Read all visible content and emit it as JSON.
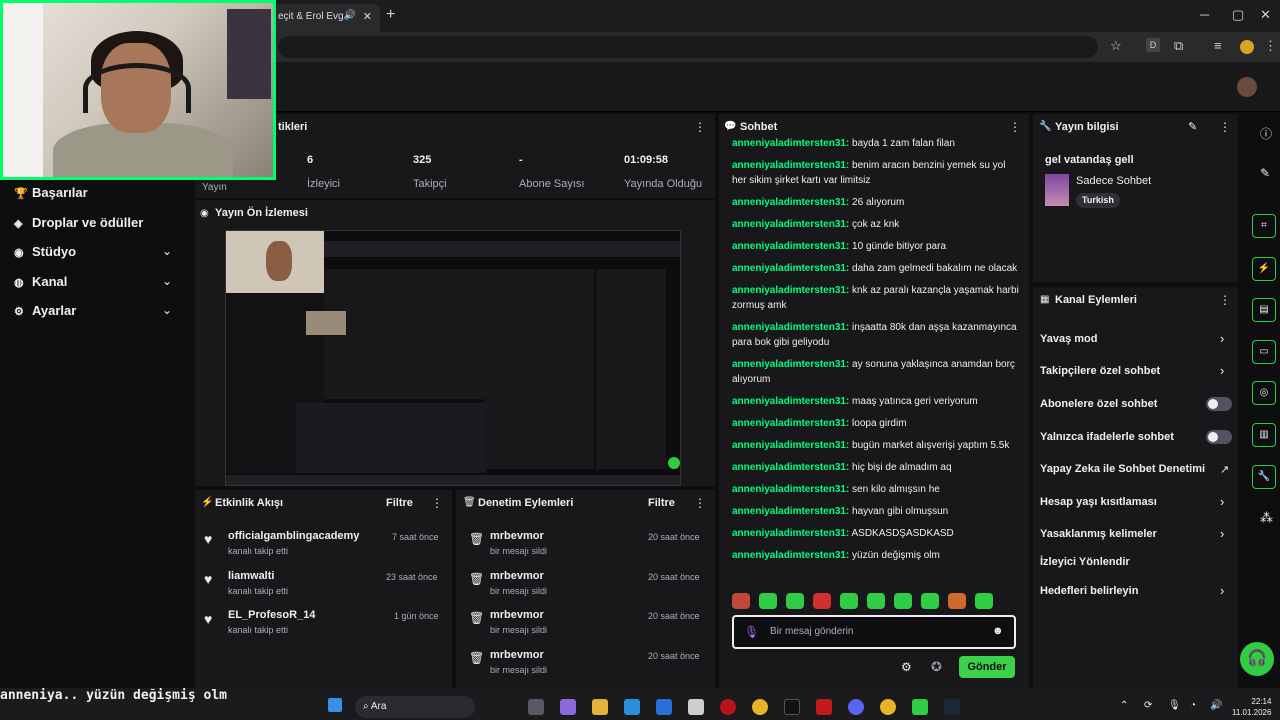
{
  "browser": {
    "tab_title": "eçit & Erol Evg",
    "tab_audio_icon": "speaker-icon",
    "new_tab": "+",
    "minimize": "─",
    "maximize": "▢",
    "close": "✕"
  },
  "sidebar": {
    "items": [
      {
        "label": "Başarılar",
        "icon": "trophy-icon",
        "glyph": "🏆",
        "chevron": false
      },
      {
        "label": "Droplar ve ödüller",
        "icon": "gift-icon",
        "glyph": "◈",
        "chevron": false
      },
      {
        "label": "Stüdyo",
        "icon": "studio-icon",
        "glyph": "◉",
        "chevron": true
      },
      {
        "label": "Kanal",
        "icon": "channel-icon",
        "glyph": "◍",
        "chevron": true
      },
      {
        "label": "Ayarlar",
        "icon": "gear-icon",
        "glyph": "⚙",
        "chevron": true
      }
    ],
    "chevron_glyph": "⌄"
  },
  "stats": {
    "title_fragment": "tikleri",
    "yayin_label": "Yayın",
    "items": [
      {
        "value": "6",
        "label": "İzleyici"
      },
      {
        "value": "325",
        "label": "Takipçi"
      },
      {
        "value": "-",
        "label": "Abone Sayısı"
      },
      {
        "value": "01:09:58",
        "label": "Yayında Olduğu"
      }
    ]
  },
  "preview": {
    "title": "Yayın Ön İzlemesi"
  },
  "activity": {
    "title": "Etkinlik Akışı",
    "filter": "Filtre",
    "items": [
      {
        "name": "officialgamblingacademy",
        "sub": "kanalı takip etti",
        "time": "7 saat önce"
      },
      {
        "name": "liamwalti",
        "sub": "kanalı takip etti",
        "time": "23 saat önce"
      },
      {
        "name": "EL_ProfesoR_14",
        "sub": "kanalı takip etti",
        "time": "1 gün önce"
      }
    ]
  },
  "moderation": {
    "title": "Denetim Eylemleri",
    "filter": "Filtre",
    "items": [
      {
        "name": "mrbevmor",
        "sub": "bir mesajı sildi",
        "time": "20 saat önce"
      },
      {
        "name": "mrbevmor",
        "sub": "bir mesajı sildi",
        "time": "20 saat önce"
      },
      {
        "name": "mrbevmor",
        "sub": "bir mesajı sildi",
        "time": "20 saat önce"
      },
      {
        "name": "mrbevmor",
        "sub": "bir mesajı sildi",
        "time": "20 saat önce"
      }
    ]
  },
  "chat": {
    "title": "Sohbet",
    "messages": [
      {
        "user": "anneniyaladimtersten31:",
        "text": "bayda 1 zam falan filan"
      },
      {
        "user": "anneniyaladimtersten31:",
        "text": "benim aracın benzini yemek su yol her sikim şirket kartı var limitsiz"
      },
      {
        "user": "anneniyaladimtersten31:",
        "text": "26 alıyorum"
      },
      {
        "user": "anneniyaladimtersten31:",
        "text": "çok az knk"
      },
      {
        "user": "anneniyaladimtersten31:",
        "text": "10 günde bitiyor para"
      },
      {
        "user": "anneniyaladimtersten31:",
        "text": "daha zam gelmedi bakalım ne olacak"
      },
      {
        "user": "anneniyaladimtersten31:",
        "text": "knk az paralı kazançla yaşamak harbi zormuş amk"
      },
      {
        "user": "anneniyaladimtersten31:",
        "text": "inşaatta 80k dan aşşa kazanmayınca para bok gibi geliyodu"
      },
      {
        "user": "anneniyaladimtersten31:",
        "text": "ay sonuna yaklaşınca anamdan borç alıyorum"
      },
      {
        "user": "anneniyaladimtersten31:",
        "text": "maaş yatınca geri veriyorum"
      },
      {
        "user": "anneniyaladimtersten31:",
        "text": "loopa girdim"
      },
      {
        "user": "anneniyaladimtersten31:",
        "text": "bugün market alışverişi yaptım 5.5k"
      },
      {
        "user": "anneniyaladimtersten31:",
        "text": "hiç bişi de almadım aq"
      },
      {
        "user": "anneniyaladimtersten31:",
        "text": "sen kilo almışsın he"
      },
      {
        "user": "anneniyaladimtersten31:",
        "text": "hayvan gibi olmuşsun"
      },
      {
        "user": "anneniyaladimtersten31:",
        "text": "ASDKASDŞASDKASD"
      },
      {
        "user": "anneniyaladimtersten31:",
        "text": "yüzün değişmiş olm"
      }
    ],
    "input_placeholder": "Bir mesaj gönderin",
    "send_label": "Gönder",
    "emote_color": "#2fcc44"
  },
  "stream_info": {
    "title": "Yayın bilgisi",
    "stream_title": "gel vatandaş gell",
    "category": "Sadece Sohbet",
    "tag": "Turkish"
  },
  "channel_actions": {
    "title": "Kanal Eylemleri",
    "items": [
      {
        "label": "Yavaş mod",
        "control": "chevron"
      },
      {
        "label": "Takipçilere özel sohbet",
        "control": "chevron"
      },
      {
        "label": "Abonelere özel sohbet",
        "control": "toggle"
      },
      {
        "label": "Yalnızca ifadelerle sohbet",
        "control": "toggle"
      },
      {
        "label": "Yapay Zeka ile Sohbet Denetimi",
        "control": "external"
      },
      {
        "label": "Hesap yaşı kısıtlaması",
        "control": "chevron"
      },
      {
        "label": "Yasaklanmış kelimeler",
        "control": "chevron"
      },
      {
        "label": "İzleyici Yönlendir",
        "control": "none"
      },
      {
        "label": "Hedefleri belirleyin",
        "control": "chevron"
      }
    ]
  },
  "caption": "anneniya.. yüzün değişmiş olm",
  "taskbar": {
    "search": "Ara",
    "time": "22:14",
    "date": "11.01.2026"
  },
  "colors": {
    "accent": "#00ff7f",
    "brand_green": "#2fcc44",
    "panel_bg": "#18181b",
    "page_bg": "#0e0e10"
  }
}
